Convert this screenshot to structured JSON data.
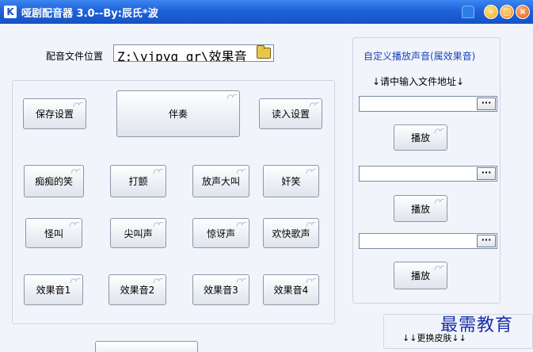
{
  "window": {
    "title": "哑剧配音器 3.0--By:辰氏*波",
    "app_icon": "K",
    "controls": {
      "skin": "shirt-icon",
      "minimize": "–",
      "maximize": "□",
      "close": "×"
    }
  },
  "path": {
    "label": "配音文件位置",
    "value": "Z:\\yjpyq_gr\\效果音"
  },
  "main_buttons": {
    "save": "保存设置",
    "accompany": "伴奏",
    "load": "读入设置"
  },
  "effects": {
    "row1": [
      "痴痴的笑",
      "打颤",
      "放声大叫",
      "奸笑"
    ],
    "row2": [
      "怪叫",
      "尖叫声",
      "惊讶声",
      "欢快歌声"
    ],
    "row3": [
      "效果音1",
      "效果音2",
      "效果音3",
      "效果音4"
    ]
  },
  "custom": {
    "title": "自定义播放声音(属效果音)",
    "hint": "↓请中输入文件地址↓",
    "browse_label": "···",
    "play_label": "播放",
    "inputs": [
      "",
      "",
      ""
    ]
  },
  "skin": {
    "label": "↓↓更换皮肤↓↓"
  },
  "watermark": "最需教育"
}
